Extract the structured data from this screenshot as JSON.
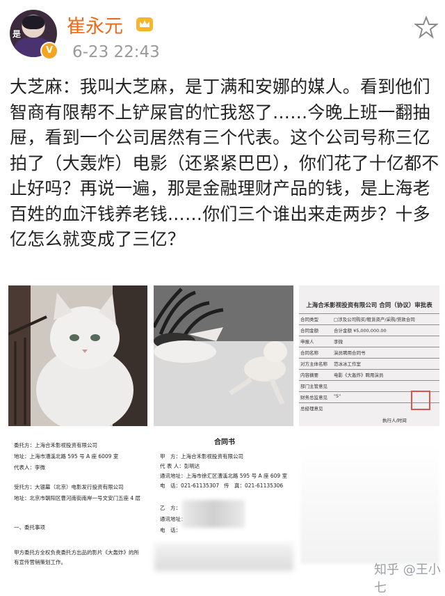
{
  "user": {
    "name": "崔永元",
    "timestamp": "6-23 22:43",
    "avatar_text": "是",
    "verified_badge": "V"
  },
  "post": {
    "text": "大芝麻：我叫大芝麻，是丁满和安娜的媒人。看到他们智商有限帮不上铲屎官的忙我怒了……今晚上班一翻抽屉，看到一个公司居然有三个代表。这个公司号称三亿拍了（大轰炸）电影（还紧紧巴巴），你们花了十亿都不止好吗？再说一遍，那是金融理财产品的钱，是上海老百姓的血汗钱养老钱……你们三个谁出来走两步？十多亿怎么就变成了三亿？"
  },
  "images": {
    "form": {
      "title": "上海合禾影视投资有限公司 合同（协议）审批表",
      "rows": [
        {
          "label": "合同类型",
          "value": "□涉及公司购买/租赁资产/采购/贷款合同"
        },
        {
          "label": "合同金额",
          "value": "合计金额 ¥5,000,000.00"
        },
        {
          "label": "申报人",
          "value": "李微"
        },
        {
          "label": "合同名称",
          "value": "演员聘用合同书"
        },
        {
          "label": "对方主体名称",
          "value": "范冰冰工作室"
        },
        {
          "label": "内容摘要",
          "value": "电影《大轰炸》聘用演员"
        },
        {
          "label": "部门主管意见",
          "value": ""
        },
        {
          "label": "财务总监意见",
          "value": "\"5\""
        },
        {
          "label": "总经理意见",
          "value": ""
        }
      ],
      "footer": "执行人/时间"
    },
    "doc_left": {
      "lines": [
        "委托方：上海合禾影视投资有限公司",
        "地址：上海市漕溪北路 595 号 A 座 6009 室",
        "代表人：李微",
        "受托方：大银幕（北京）电影发行投资有限公司",
        "地址：北京市朝阳区曹河南街南岸一号文安门五座 4 层",
        "一、委托事项",
        "甲方委托方全权负责委托方出品的影片《大轰炸》的所",
        "有宣传营销策划工作。"
      ]
    },
    "doc_right": {
      "title": "合同书",
      "lines": [
        "甲　方：上海合禾影视投资有限公司",
        "代 表 人：彭明达",
        "通讯地址：上海市徐汇区漕溪北路 595 号 A 座 609 室",
        "电　话：021-61135307",
        "传　真：021-61135306",
        "乙　方：",
        "通讯地址：",
        "电　话："
      ]
    }
  },
  "watermark": "知乎 @王小七",
  "colors": {
    "username": "#ec6a18",
    "timestamp": "#9a9a9a",
    "badge": "#f4a623"
  }
}
